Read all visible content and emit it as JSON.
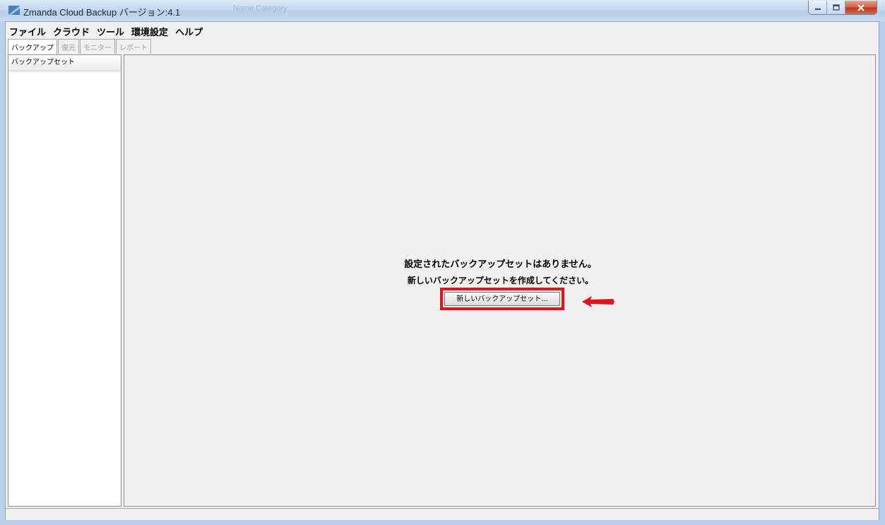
{
  "window": {
    "title": "Zmanda Cloud Backup バージョン:4.1",
    "background_ghost_texts": [
      "Name",
      "Category"
    ],
    "caption_buttons": [
      "minimize-icon",
      "maximize-icon",
      "close-icon"
    ]
  },
  "menu": {
    "items": [
      {
        "label": "ファイル"
      },
      {
        "label": "クラウド"
      },
      {
        "label": "ツール"
      },
      {
        "label": "環境設定"
      },
      {
        "label": "ヘルプ"
      }
    ]
  },
  "tabs": [
    {
      "label": "バックアップ",
      "state": "active"
    },
    {
      "label": "復元",
      "state": "disabled"
    },
    {
      "label": "モニター",
      "state": "disabled"
    },
    {
      "label": "レポート",
      "state": "disabled"
    }
  ],
  "sidebar": {
    "header": "バックアップセット"
  },
  "main": {
    "message_line1": "設定されたバックアップセットはありません。",
    "message_line2": "新しいバックアップセットを作成してください。",
    "new_backup_button": "新しいバックアップセット...",
    "highlight_color": "#e0141d",
    "annotation_arrow_color": "#e0141d"
  }
}
